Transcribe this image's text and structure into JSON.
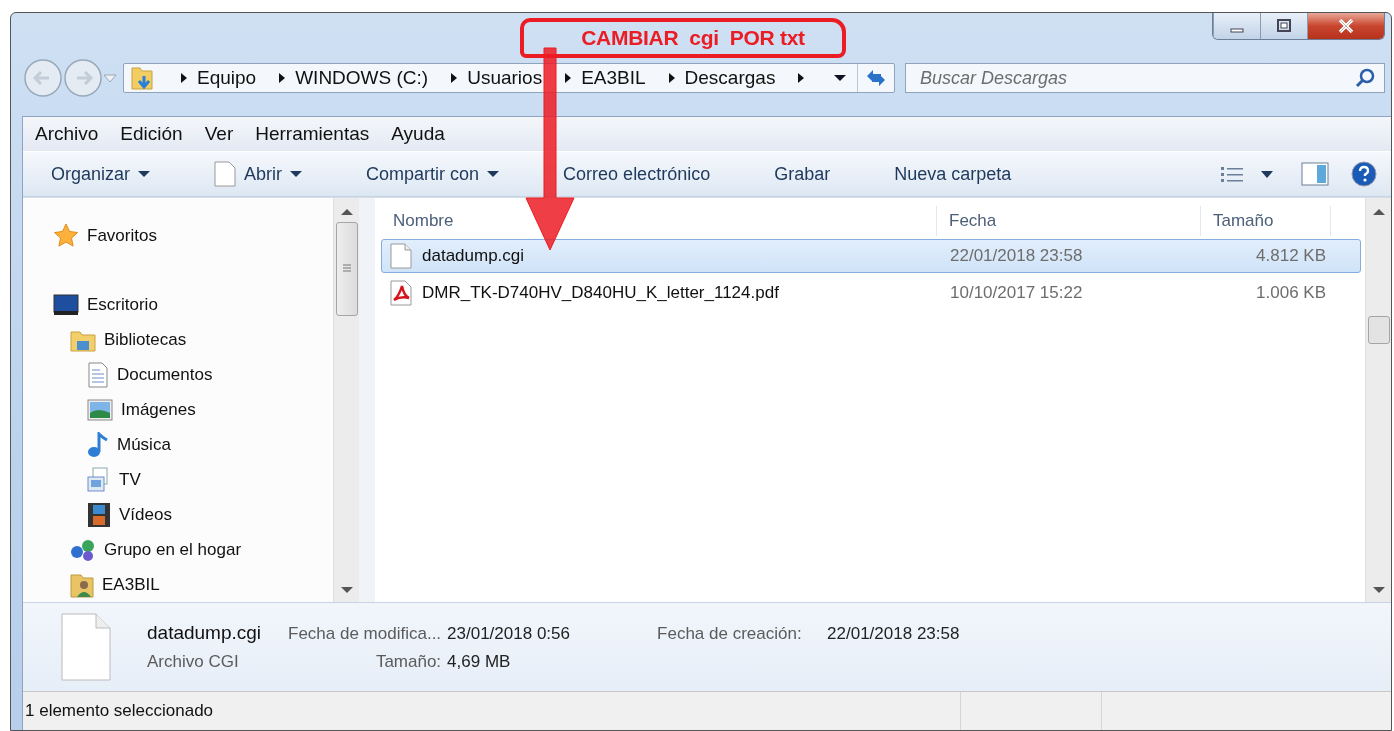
{
  "annotation": {
    "text": "CAMBIAR  cgi  POR txt"
  },
  "window": {
    "controls": [
      {
        "kind": "minimize"
      },
      {
        "kind": "maximize"
      },
      {
        "kind": "close"
      }
    ]
  },
  "address": {
    "crumbs": [
      "Equipo",
      "WINDOWS (C:)",
      "Usuarios",
      "EA3BIL",
      "Descargas"
    ]
  },
  "search": {
    "placeholder": "Buscar Descargas"
  },
  "menu": [
    "Archivo",
    "Edición",
    "Ver",
    "Herramientas",
    "Ayuda"
  ],
  "toolbar": [
    {
      "label": "Organizar",
      "kind": "dropdown"
    },
    {
      "label": "Abrir",
      "kind": "document-dropdown"
    },
    {
      "label": "Compartir con",
      "kind": "dropdown"
    },
    {
      "label": "Correo electrónico",
      "kind": "plain"
    },
    {
      "label": "Grabar",
      "kind": "plain"
    },
    {
      "label": "Nueva carpeta",
      "kind": "plain"
    }
  ],
  "nav": {
    "items": [
      {
        "label": "Favoritos",
        "kind": "star"
      },
      {
        "label": "Escritorio",
        "kind": "desktop",
        "children": [
          {
            "label": "Bibliotecas",
            "kind": "library",
            "children": [
              {
                "label": "Documentos",
                "kind": "document"
              },
              {
                "label": "Imágenes",
                "kind": "picture"
              },
              {
                "label": "Música",
                "kind": "music"
              },
              {
                "label": "TV",
                "kind": "tv"
              },
              {
                "label": "Vídeos",
                "kind": "video"
              }
            ]
          },
          {
            "label": "Grupo en el hogar",
            "kind": "homegroup"
          },
          {
            "label": "EA3BIL",
            "kind": "user"
          }
        ]
      }
    ]
  },
  "file_list": {
    "columns": [
      "Nombre",
      "Fecha",
      "Tamaño"
    ],
    "rows": [
      {
        "name": "datadump.cgi",
        "date": "22/01/2018 23:58",
        "size": "4.812 KB",
        "kind": "file",
        "selected": true
      },
      {
        "name": "DMR_TK-D740HV_D840HU_K_letter_1124.pdf",
        "date": "10/10/2017 15:22",
        "size": "1.006 KB",
        "kind": "pdf",
        "selected": false
      }
    ]
  },
  "details": {
    "name": "datadump.cgi",
    "type": "Archivo CGI",
    "fields": [
      {
        "label": "Fecha de modifica...",
        "value": "23/01/2018 0:56"
      },
      {
        "label": "Tamaño:",
        "value": "4,69 MB"
      },
      {
        "label": "Fecha de creación:",
        "value": "22/01/2018 23:58"
      }
    ]
  },
  "status_bar": {
    "text": "1 elemento seleccionado"
  }
}
